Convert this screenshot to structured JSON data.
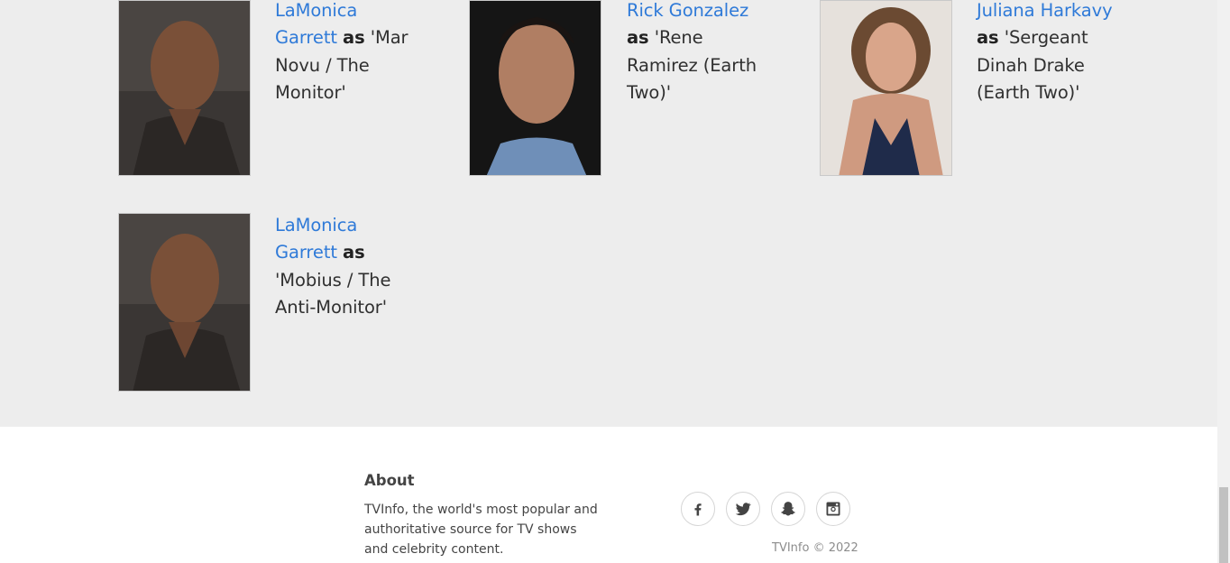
{
  "cast": [
    {
      "actor": "LaMonica Garrett",
      "connector": "as",
      "role": "'Mar Novu / The Monitor'",
      "photo_icon": "actor-photo"
    },
    {
      "actor": "Rick Gonzalez",
      "connector": "as",
      "role": "'Rene Ramirez (Earth Two)'",
      "photo_icon": "actor-photo"
    },
    {
      "actor": "Juliana Harkavy",
      "connector": "as",
      "role": "'Sergeant Dinah Drake (Earth Two)'",
      "photo_icon": "actress-photo"
    },
    {
      "actor": "LaMonica Garrett",
      "connector": "as",
      "role": "'Mobius / The Anti-Monitor'",
      "photo_icon": "actor-photo"
    }
  ],
  "footer": {
    "about_title": "About",
    "about_text": "TVInfo, the world's most popular and authoritative source for TV shows and celebrity content.",
    "social": [
      "facebook-icon",
      "twitter-icon",
      "snapchat-icon",
      "instagram-icon"
    ],
    "copyright": "TVInfo © 2022"
  },
  "colors": {
    "link": "#2f7ad8",
    "cast_background": "#ededed",
    "footer_background": "#ffffff"
  }
}
